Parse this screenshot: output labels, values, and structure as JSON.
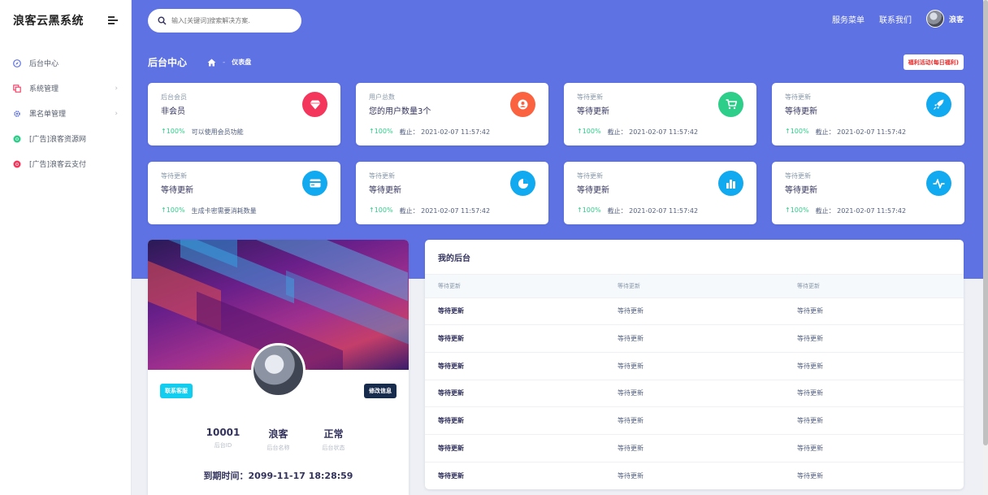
{
  "brand": {
    "title": "浪客云黑系统"
  },
  "sidebar": {
    "items": [
      {
        "label": "后台中心",
        "icon": "compass-icon",
        "color": "#5e72e4",
        "has_arrow": false
      },
      {
        "label": "系统管理",
        "icon": "window-icon",
        "color": "#f5365c",
        "has_arrow": true
      },
      {
        "label": "黑名单管理",
        "icon": "gear-icon",
        "color": "#5e72e4",
        "has_arrow": true
      },
      {
        "label": "[广告]浪客资源网",
        "icon": "chrome-icon",
        "color": "#2dce89",
        "has_arrow": false
      },
      {
        "label": "[广告]浪客云支付",
        "icon": "chrome-icon",
        "color": "#f5365c",
        "has_arrow": false
      }
    ],
    "arrow": "›"
  },
  "header": {
    "search_placeholder": "输入[关键词]搜索解决方案.",
    "links": [
      "服务菜单",
      "联系我们"
    ],
    "user_name": "浪客"
  },
  "page": {
    "title": "后台中心",
    "breadcrumb_sep": "-",
    "breadcrumb_current": "仪表盘",
    "promo_label": "福利活动(每日福利)"
  },
  "stats": [
    {
      "label": "后台会员",
      "value": "非会员",
      "pct": "↑100%",
      "note": "可以使用会员功能",
      "icon": "diamond-icon",
      "color": "#f5365c"
    },
    {
      "label": "用户总数",
      "value": "您的用户数量3个",
      "pct": "↑100%",
      "note": "截止：  2021-02-07 11:57:42",
      "icon": "user-icon",
      "color": "#fb6340"
    },
    {
      "label": "等待更新",
      "value": "等待更新",
      "pct": "↑100%",
      "note": "截止：  2021-02-07 11:57:42",
      "icon": "cart-icon",
      "color": "#2dce89"
    },
    {
      "label": "等待更新",
      "value": "等待更新",
      "pct": "↑100%",
      "note": "截止：  2021-02-07 11:57:42",
      "icon": "rocket-icon",
      "color": "#11a9ef"
    },
    {
      "label": "等待更新",
      "value": "等待更新",
      "pct": "↑100%",
      "note": "生成卡密需要消耗数量",
      "icon": "card-icon",
      "color": "#11a9ef"
    },
    {
      "label": "等待更新",
      "value": "等待更新",
      "pct": "↑100%",
      "note": "截止：  2021-02-07 11:57:42",
      "icon": "pie-icon",
      "color": "#11a9ef"
    },
    {
      "label": "等待更新",
      "value": "等待更新",
      "pct": "↑100%",
      "note": "截止：  2021-02-07 11:57:42",
      "icon": "bar-chart-icon",
      "color": "#11a9ef"
    },
    {
      "label": "等待更新",
      "value": "等待更新",
      "pct": "↑100%",
      "note": "截止：  2021-02-07 11:57:42",
      "icon": "pulse-icon",
      "color": "#11a9ef"
    }
  ],
  "profile": {
    "contact_label": "联系客服",
    "edit_label": "修改信息",
    "stats": [
      {
        "value": "10001",
        "label": "后台ID"
      },
      {
        "value": "浪客",
        "label": "后台名称"
      },
      {
        "value": "正常",
        "label": "后台状态"
      }
    ],
    "expire": "到期时间：2099-11-17 18:28:59"
  },
  "table": {
    "title": "我的后台",
    "headers": [
      "等待更新",
      "等待更新",
      "等待更新"
    ],
    "rows": [
      [
        "等待更新",
        "等待更新",
        "等待更新"
      ],
      [
        "等待更新",
        "等待更新",
        "等待更新"
      ],
      [
        "等待更新",
        "等待更新",
        "等待更新"
      ],
      [
        "等待更新",
        "等待更新",
        "等待更新"
      ],
      [
        "等待更新",
        "等待更新",
        "等待更新"
      ],
      [
        "等待更新",
        "等待更新",
        "等待更新"
      ],
      [
        "等待更新",
        "等待更新",
        "等待更新"
      ]
    ]
  }
}
